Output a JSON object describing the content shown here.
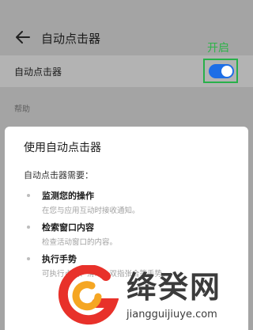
{
  "appbar": {
    "title": "自动点击器",
    "back_icon": "arrow-left-icon"
  },
  "setting": {
    "label": "自动点击器",
    "toggle_on": true,
    "annotation": "开启",
    "accent": "#1d6ee6",
    "highlight": "#28b04a"
  },
  "help": {
    "label": "帮助"
  },
  "dialog": {
    "title": "使用自动点击器",
    "intro": "自动点击器需要：",
    "items": [
      {
        "title": "监测您的操作",
        "desc": "在您与应用互动时接收通知。"
      },
      {
        "title": "检索窗口内容",
        "desc": "检查活动窗口的内容。"
      },
      {
        "title": "执行手势",
        "desc": "可执行点按、滑动、双指张合等手势。"
      }
    ]
  },
  "watermark": {
    "text": "绛癸网",
    "url": "jiangguijiuye.com",
    "logo_colors": [
      "#f5a623",
      "#e8312a"
    ]
  }
}
